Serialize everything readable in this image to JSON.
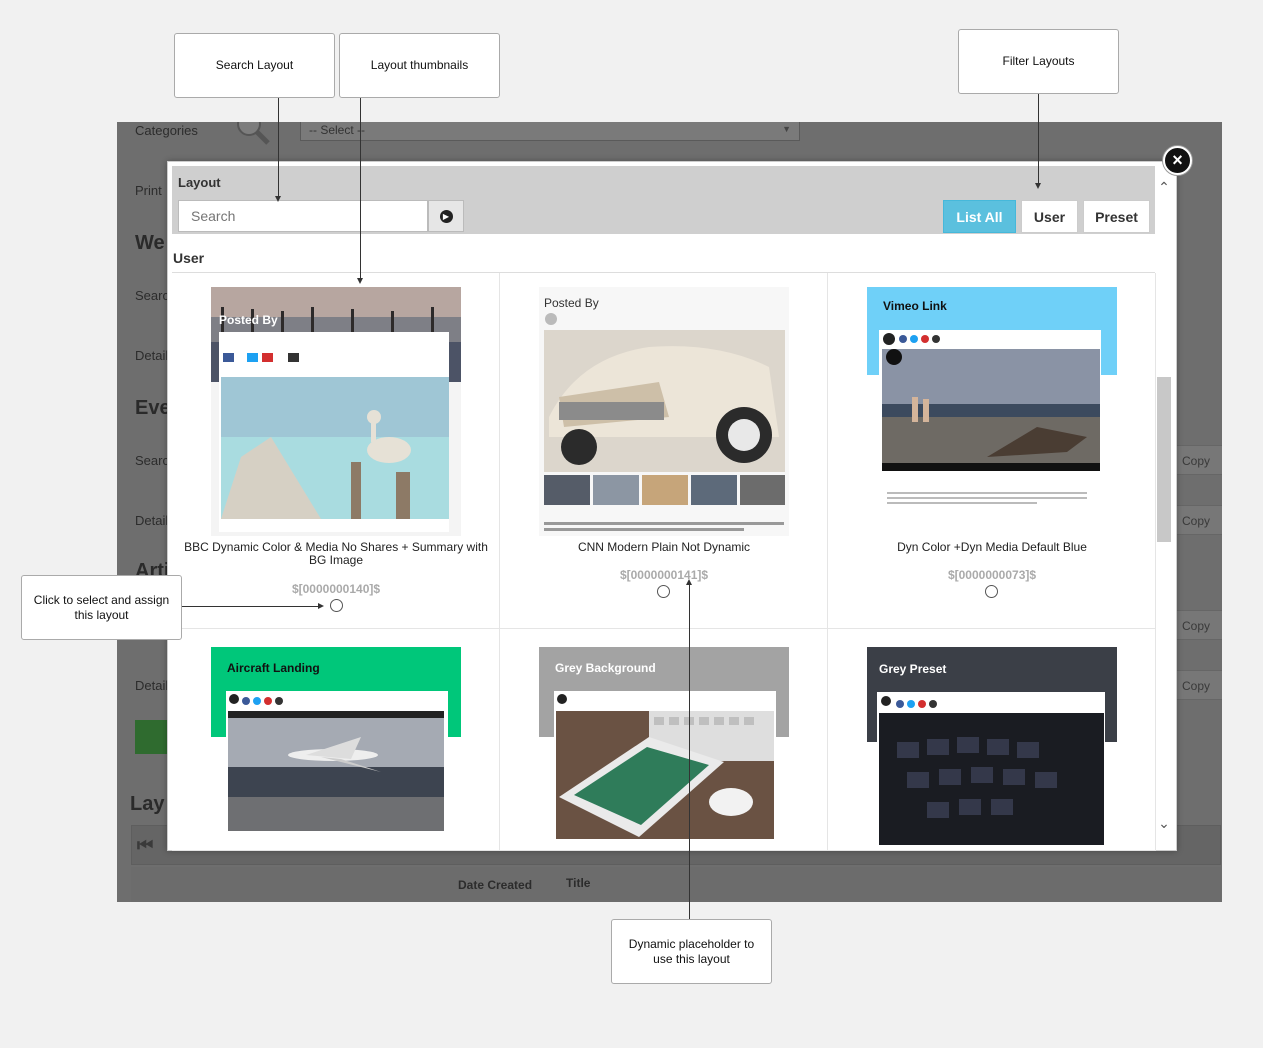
{
  "background_page": {
    "categories_label": "Categories",
    "select_value": "-- Select --",
    "print_label": "Print",
    "heading_web": "We",
    "search_label": "Searc",
    "details_label": "Detail",
    "heading_events": "Eve",
    "heading_articles": "Arti",
    "heading_layouts": "Lay",
    "copy_label": "Copy",
    "date_created": "Date Created",
    "title_col": "Title"
  },
  "modal": {
    "title": "Layout",
    "search_placeholder": "Search",
    "filters": {
      "list_all": "List All",
      "user": "User",
      "preset": "Preset"
    },
    "section": "User",
    "close_icon": "close-icon"
  },
  "layouts": [
    {
      "title": "BBC Dynamic Color & Media No Shares + Summary with BG Image",
      "placeholder": "$[0000000140]$",
      "thumb_heading": "Posted By"
    },
    {
      "title": "CNN Modern Plain Not Dynamic",
      "placeholder": "$[0000000141]$",
      "thumb_heading": "Posted By"
    },
    {
      "title": "Dyn Color +Dyn Media Default Blue",
      "placeholder": "$[0000000073]$",
      "thumb_heading": "Vimeo Link"
    },
    {
      "title": "",
      "placeholder": "",
      "thumb_heading": "Aircraft Landing"
    },
    {
      "title": "",
      "placeholder": "",
      "thumb_heading": "Grey Background"
    },
    {
      "title": "",
      "placeholder": "",
      "thumb_heading": "Grey Preset"
    }
  ],
  "callouts": {
    "search_layout": "Search Layout",
    "layout_thumbnails": "Layout thumbnails",
    "filter_layouts": "Filter Layouts",
    "click_to_select": "Click to select and assign this layout",
    "dynamic_placeholder": "Dynamic placeholder to use this layout"
  },
  "colors": {
    "list_all_bg": "#5bc0de",
    "blue_thumb": "#6fd0f8",
    "green_thumb": "#00c77a",
    "grey_thumb": "#a3a3a3",
    "dark_thumb": "#3b3f47"
  }
}
